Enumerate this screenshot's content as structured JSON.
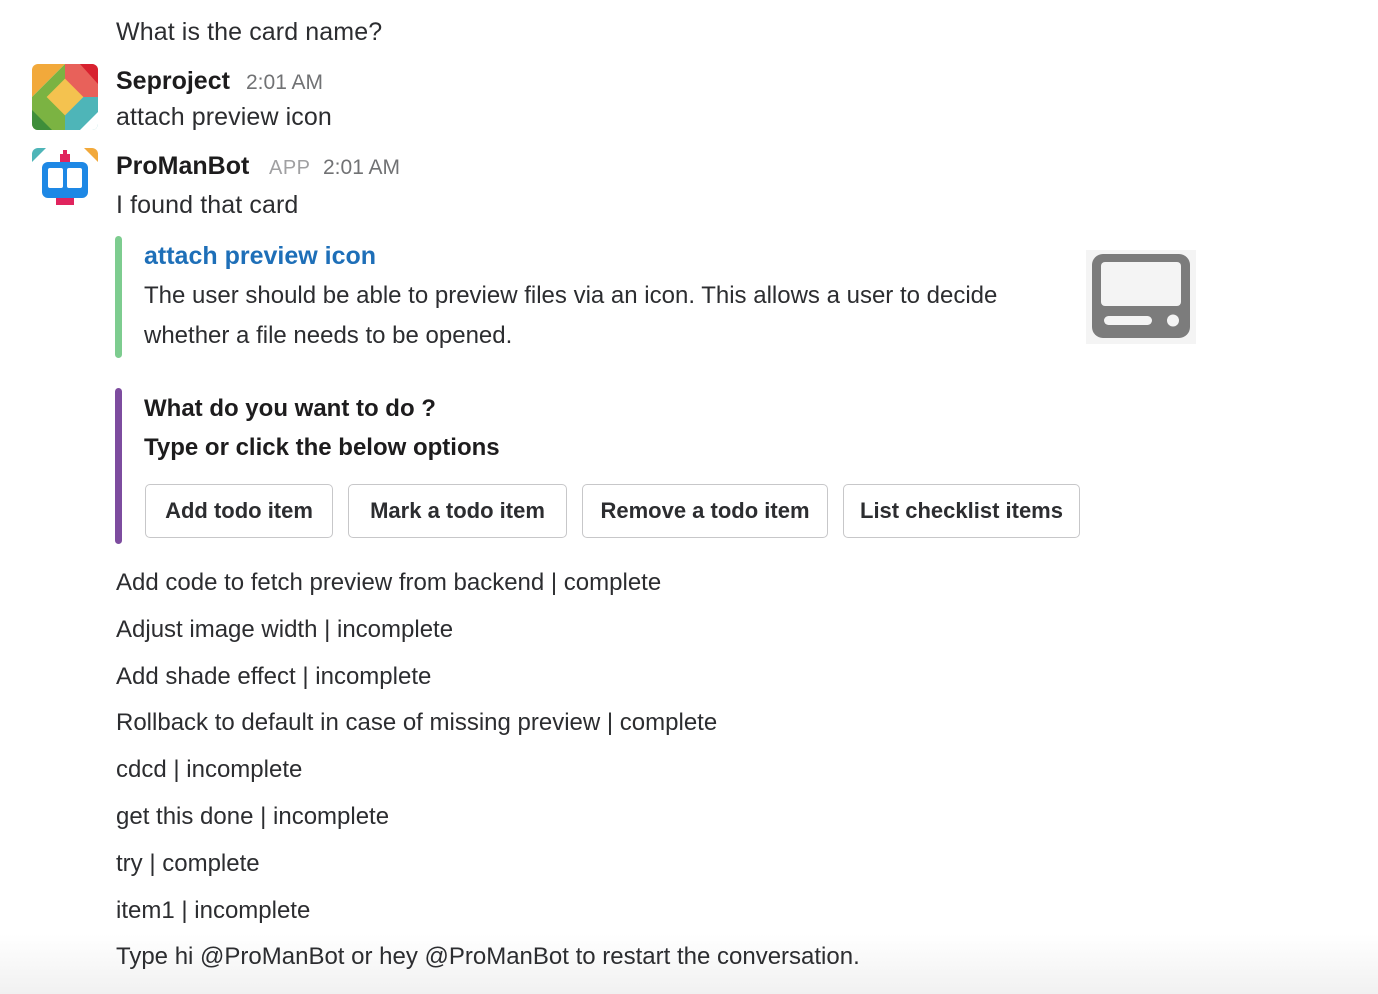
{
  "prev_message": {
    "text": "What is the card name?"
  },
  "message_user": {
    "sender": "Seproject",
    "time": "2:01 AM",
    "text": "attach preview icon"
  },
  "message_bot": {
    "sender": "ProManBot",
    "badge": "APP",
    "time": "2:01 AM",
    "text": "I found that card",
    "card_attachment": {
      "title": "attach preview icon",
      "description": "The user should be able to preview files via an icon. This allows a user to decide whether a file needs to be opened.",
      "bar_color": "#7dcc8f",
      "thumbnail_icon": "monitor-icon"
    },
    "actions_attachment": {
      "prompt_line1": "What do you want to do ?",
      "prompt_line2": "Type or click the below options",
      "bar_color": "#7d4c9f",
      "buttons": [
        {
          "label": "Add todo item"
        },
        {
          "label": "Mark a todo item"
        },
        {
          "label": "Remove a todo item"
        },
        {
          "label": "List checklist items"
        }
      ]
    },
    "checklist": [
      "Add code to fetch preview from backend | complete",
      "Adjust image width | incomplete",
      "Add shade effect | incomplete",
      "Rollback to default in case of missing preview | complete",
      "cdcd | incomplete",
      "get this done | incomplete",
      "try | complete",
      "item1 | incomplete"
    ],
    "footer": "Type hi @ProManBot or hey @ProManBot to restart the conversation."
  }
}
